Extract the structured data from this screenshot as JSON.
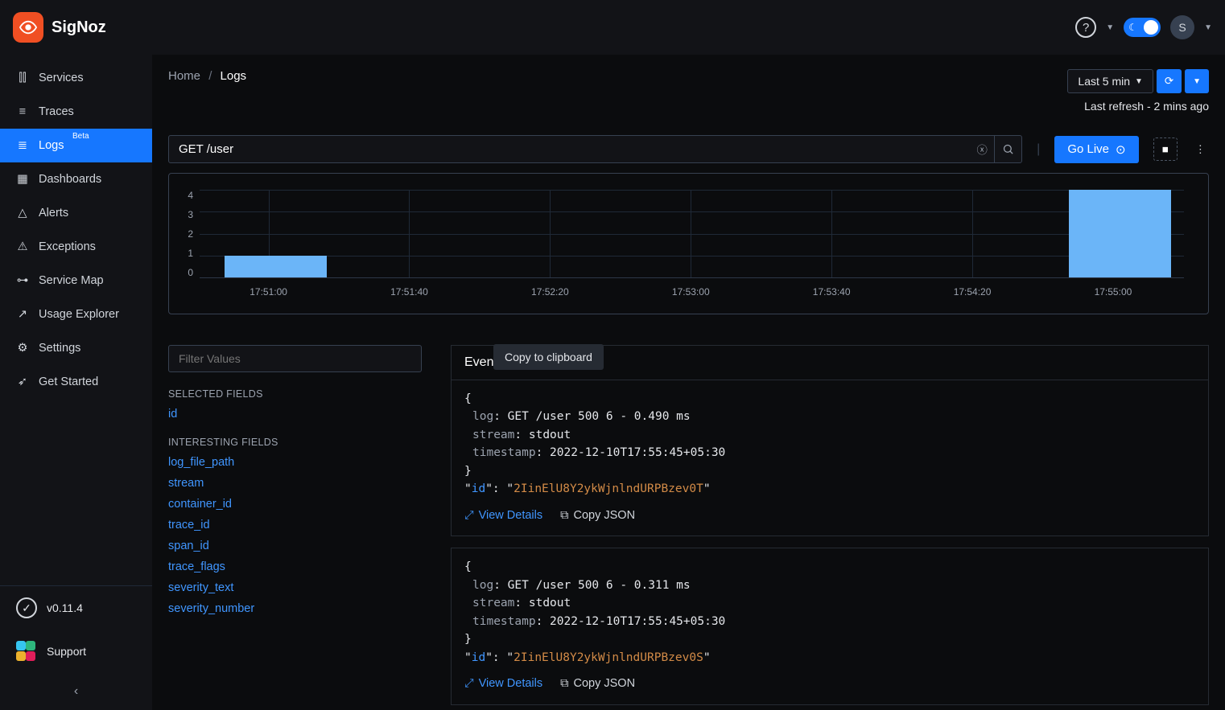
{
  "brand": "SigNoz",
  "header": {
    "avatar_initial": "S"
  },
  "sidebar": {
    "items": [
      {
        "label": "Services"
      },
      {
        "label": "Traces"
      },
      {
        "label": "Logs",
        "badge": "Beta",
        "active": true
      },
      {
        "label": "Dashboards"
      },
      {
        "label": "Alerts"
      },
      {
        "label": "Exceptions"
      },
      {
        "label": "Service Map"
      },
      {
        "label": "Usage Explorer"
      },
      {
        "label": "Settings"
      },
      {
        "label": "Get Started"
      }
    ],
    "version": "v0.11.4",
    "support": "Support"
  },
  "breadcrumb": {
    "home": "Home",
    "current": "Logs"
  },
  "time": {
    "range": "Last 5 min",
    "refresh_text": "Last refresh - 2 mins ago"
  },
  "search": {
    "value": "GET /user",
    "golive": "Go Live"
  },
  "chart_data": {
    "type": "bar",
    "categories": [
      "17:51:00",
      "17:51:40",
      "17:52:20",
      "17:53:00",
      "17:53:40",
      "17:54:20",
      "17:55:00"
    ],
    "values": [
      1,
      0,
      0,
      0,
      0,
      0,
      4
    ],
    "title": "",
    "xlabel": "",
    "ylabel": "",
    "ylim": [
      0,
      4
    ],
    "yticks": [
      "4",
      "3",
      "2",
      "1",
      "0"
    ]
  },
  "fields": {
    "filter_placeholder": "Filter Values",
    "selected_header": "SELECTED FIELDS",
    "selected": [
      "id"
    ],
    "interesting_header": "INTERESTING FIELDS",
    "interesting": [
      "log_file_path",
      "stream",
      "container_id",
      "trace_id",
      "span_id",
      "trace_flags",
      "severity_text",
      "severity_number"
    ]
  },
  "events": {
    "header": "Event",
    "tooltip": "Copy to clipboard",
    "entries": [
      {
        "log": "GET /user 500 6 - 0.490 ms",
        "stream": "stdout",
        "timestamp": "2022-12-10T17:55:45+05:30",
        "id": "2IinElU8Y2ykWjnlndURPBzev0T"
      },
      {
        "log": "GET /user 500 6 - 0.311 ms",
        "stream": "stdout",
        "timestamp": "2022-12-10T17:55:45+05:30",
        "id": "2IinElU8Y2ykWjnlndURPBzev0S"
      }
    ],
    "view_details": "View Details",
    "copy_json": "Copy JSON",
    "keys": {
      "log": "log",
      "stream": "stream",
      "timestamp": "timestamp",
      "id": "id"
    }
  }
}
